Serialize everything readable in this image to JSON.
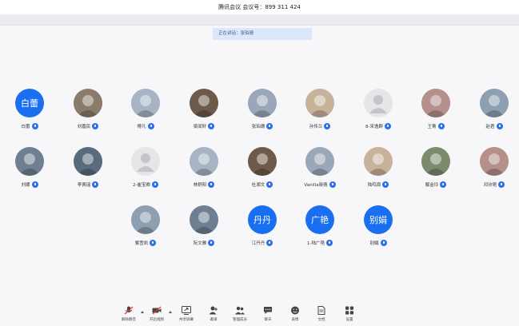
{
  "meeting": {
    "title": "腾讯会议 会议号：899 311 424"
  },
  "speaking": {
    "text": "正在讲话：张珀珊"
  },
  "participants": [
    {
      "name": "白蕾",
      "avatar_text": "白蕾",
      "avatar_type": "text"
    },
    {
      "name": "刘嘉民",
      "avatar_type": "img"
    },
    {
      "name": "傅凡",
      "avatar_type": "img"
    },
    {
      "name": "梁闻轩",
      "avatar_type": "img"
    },
    {
      "name": "张珀珊",
      "avatar_type": "img"
    },
    {
      "name": "孙传兰",
      "avatar_type": "img"
    },
    {
      "name": "8-宋逸群",
      "avatar_type": "default"
    },
    {
      "name": "王菁",
      "avatar_type": "img"
    },
    {
      "name": "赵君",
      "avatar_type": "img"
    },
    {
      "name": "刘娜",
      "avatar_type": "img"
    },
    {
      "name": "李佩瑶",
      "avatar_type": "img"
    },
    {
      "name": "2-崔宝卿",
      "avatar_type": "default"
    },
    {
      "name": "林舒阳",
      "avatar_type": "img"
    },
    {
      "name": "杜湘文",
      "avatar_type": "img"
    },
    {
      "name": "Vanilla晓倩",
      "avatar_type": "img"
    },
    {
      "name": "陆鸣周",
      "avatar_type": "img"
    },
    {
      "name": "解金玲",
      "avatar_type": "img"
    },
    {
      "name": "邓欣艳",
      "avatar_type": "img"
    },
    {
      "name": "紫萱凯",
      "avatar_type": "img"
    },
    {
      "name": "阮文雅",
      "avatar_type": "img"
    },
    {
      "name": "江丹丹",
      "avatar_text": "丹丹",
      "avatar_type": "text"
    },
    {
      "name": "1-陆广艳",
      "avatar_text": "广艳",
      "avatar_type": "text"
    },
    {
      "name": "别娟",
      "avatar_text": "别娟",
      "avatar_type": "text"
    }
  ],
  "toolbar": [
    {
      "label": "解除静音",
      "icon": "mic-muted-icon"
    },
    {
      "label": "开启视频",
      "icon": "camera-off-icon"
    },
    {
      "label": "共享屏幕",
      "icon": "share-screen-icon"
    },
    {
      "label": "邀请",
      "icon": "invite-icon"
    },
    {
      "label": "管理成员",
      "icon": "members-icon"
    },
    {
      "label": "聊天",
      "icon": "chat-icon"
    },
    {
      "label": "表情",
      "icon": "emoji-icon"
    },
    {
      "label": "文档",
      "icon": "document-icon"
    },
    {
      "label": "设置",
      "icon": "settings-icon"
    }
  ],
  "colors": {
    "accent": "#1a6ff0",
    "mic": "#2f6fe6",
    "background": "#f7f7f9"
  }
}
